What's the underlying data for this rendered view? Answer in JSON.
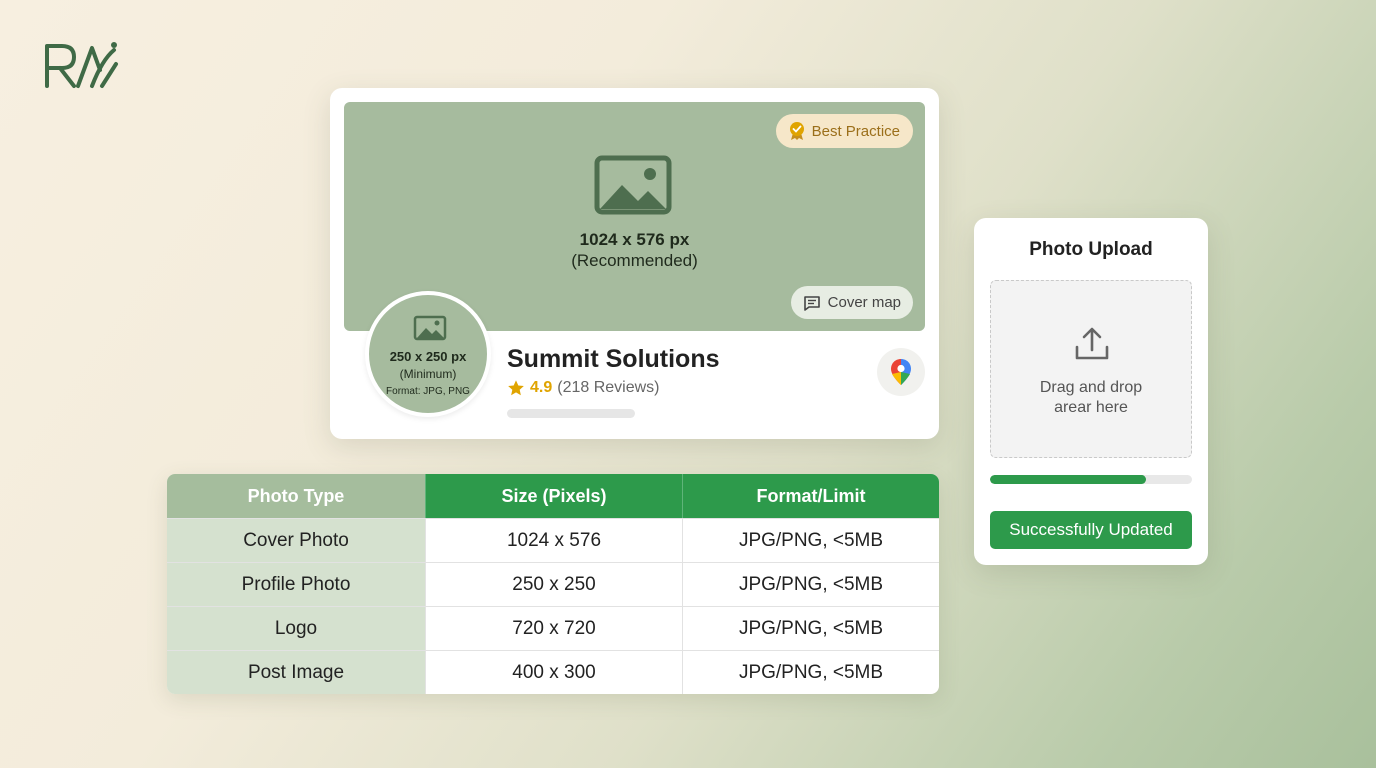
{
  "logo": {
    "text": "RA"
  },
  "profile_card": {
    "cover": {
      "size": "1024 x 576 px",
      "note": "(Recommended)",
      "badge": "Best Practice",
      "chip": "Cover map"
    },
    "avatar": {
      "size": "250 x 250 px",
      "note": "(Minimum)",
      "format": "Format: JPG, PNG"
    },
    "business_name": "Summit Solutions",
    "rating": "4.9",
    "reviews": "(218 Reviews)"
  },
  "table": {
    "headers": [
      "Photo Type",
      "Size (Pixels)",
      "Format/Limit"
    ],
    "rows": [
      [
        "Cover Photo",
        "1024 x 576",
        "JPG/PNG, <5MB"
      ],
      [
        "Profile Photo",
        "250 x 250",
        "JPG/PNG, <5MB"
      ],
      [
        "Logo",
        "720 x 720",
        "JPG/PNG, <5MB"
      ],
      [
        "Post Image",
        "400 x 300",
        "JPG/PNG, <5MB"
      ]
    ]
  },
  "upload": {
    "title": "Photo Upload",
    "drop_line1": "Drag and drop",
    "drop_line2": "arear here",
    "progress": 0.77,
    "button": "Successfully Updated"
  },
  "colors": {
    "accent": "#2d9a4b",
    "sage": "#a6bb9e",
    "gold": "#e0a400"
  },
  "icons": [
    "logo-mark",
    "image-placeholder-icon",
    "award-badge-icon",
    "comment-icon",
    "star-icon",
    "map-pin-icon",
    "upload-icon"
  ]
}
